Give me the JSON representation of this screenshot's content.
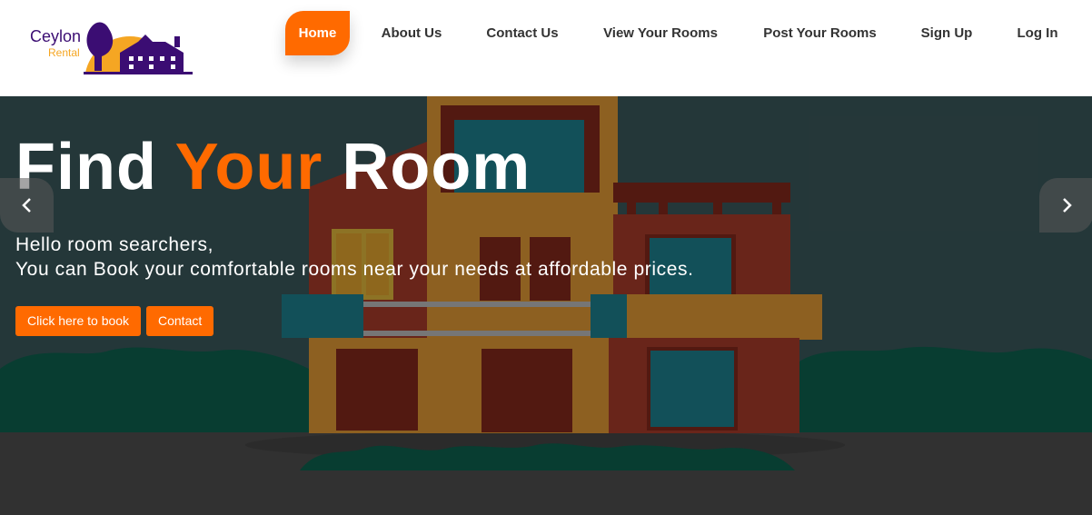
{
  "brand": {
    "name": "Ceylon",
    "tagline": "Rental"
  },
  "nav": {
    "items": [
      {
        "label": "Home",
        "active": true
      },
      {
        "label": "About Us"
      },
      {
        "label": "Contact Us"
      },
      {
        "label": "View Your Rooms"
      },
      {
        "label": "Post Your Rooms"
      },
      {
        "label": "Sign Up"
      },
      {
        "label": "Log In"
      }
    ]
  },
  "hero": {
    "title_part1": "Find",
    "title_accent": "Your",
    "title_part2": "Room",
    "subtitle_line1": "Hello room searchers,",
    "subtitle_line2": "You can Book your comfortable rooms near your needs at affordable prices.",
    "book_button": "Click here to book",
    "contact_button": "Contact",
    "prev_icon": "chevron-left-icon",
    "next_icon": "chevron-right-icon"
  },
  "colors": {
    "accent": "#ff6a00",
    "brand_purple": "#3b0d73",
    "brand_orange": "#f5a623"
  }
}
